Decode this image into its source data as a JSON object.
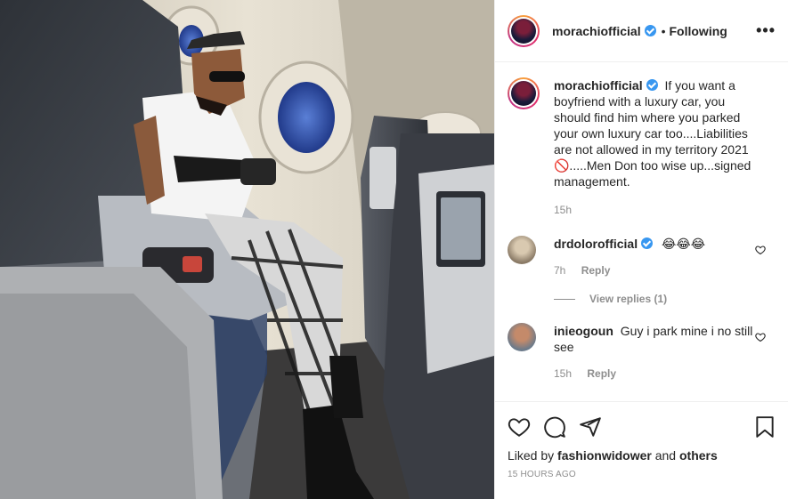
{
  "post": {
    "author": "morachiofficial",
    "following_label": "Following",
    "caption_user": "morachiofficial",
    "caption": "If you want a boyfriend with a luxury car, you should find him where you parked your own luxury car too....Liabilities are not allowed in my territory 2021 🚫.....Men Don too wise up...signed management.",
    "caption_time": "15h"
  },
  "comments": [
    {
      "user": "drdolorofficial",
      "text": "😂😂😂",
      "time": "7h",
      "reply_label": "Reply",
      "view_replies": "View replies (1)"
    },
    {
      "user": "inieogoun",
      "text": "Guy i park mine i no still see",
      "time": "15h",
      "reply_label": "Reply"
    }
  ],
  "likes": {
    "prefix": "Liked by",
    "user": "fashionwidower",
    "conj": "and",
    "others": "others"
  },
  "timestamp": "15 HOURS AGO",
  "icons": [
    "more-icon",
    "heart-icon",
    "comment-icon",
    "share-icon",
    "save-icon",
    "verified-icon"
  ]
}
